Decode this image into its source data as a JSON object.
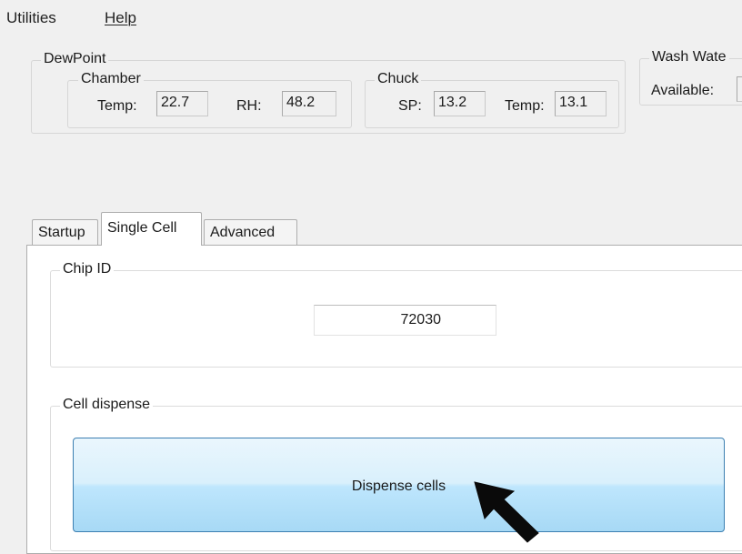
{
  "menu": {
    "items": [
      {
        "label": "Utilities",
        "mnemonic": ""
      },
      {
        "label": "Help",
        "mnemonic": "H"
      }
    ]
  },
  "dewpoint": {
    "title": "DewPoint",
    "chamber": {
      "title": "Chamber",
      "temp_label": "Temp:",
      "temp_value": "22.7",
      "rh_label": "RH:",
      "rh_value": "48.2"
    },
    "chuck": {
      "title": "Chuck",
      "sp_label": "SP:",
      "sp_value": "13.2",
      "temp_label": "Temp:",
      "temp_value": "13.1"
    }
  },
  "wash_water": {
    "title": "Wash Wate",
    "available_label": "Available:"
  },
  "tabs": [
    {
      "label": "Startup",
      "selected": false
    },
    {
      "label": "Single Cell",
      "selected": true
    },
    {
      "label": "Advanced",
      "selected": false
    }
  ],
  "single_cell": {
    "chip_id": {
      "title": "Chip ID",
      "value": "72030"
    },
    "cell_dispense": {
      "title": "Cell dispense",
      "button_label": "Dispense cells"
    }
  },
  "colors": {
    "window_bg": "#f0f0f0",
    "panel_bg": "#ffffff",
    "button_border": "#3c7fb1",
    "button_fill": "#bee6fd"
  },
  "icons": {
    "pointer": "mouse-pointer-icon"
  }
}
